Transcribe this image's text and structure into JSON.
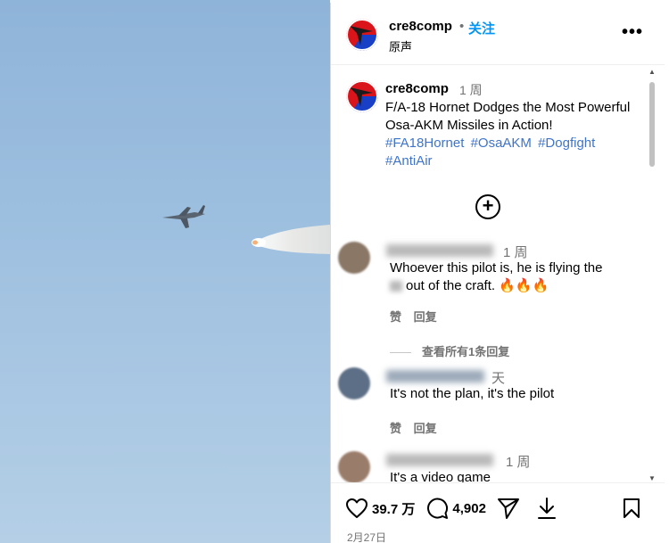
{
  "post": {
    "username": "cre8comp",
    "follow_label": "关注",
    "audio_label": "原声",
    "more_label": "•••",
    "caption_time": "1 周",
    "caption_text": "F/A-18 Hornet Dodges the Most Powerful Osa-AKM Missiles in Action!",
    "hashtags": [
      "#FA18Hornet",
      "#OsaAKM",
      "#Dogfight",
      "#AntiAir"
    ],
    "date": "2月27日"
  },
  "comments": [
    {
      "time": "1 周",
      "text_line1": "Whoever this pilot is, he is flying the",
      "text_line2": "out of the craft. 🔥🔥🔥",
      "like_label": "赞",
      "reply_label": "回复"
    },
    {
      "time": "天",
      "text_line1": "It's not the plan, it's the pilot",
      "like_label": "赞",
      "reply_label": "回复"
    },
    {
      "time": "1 周",
      "text_line1": "It's a video game"
    }
  ],
  "view_replies_label": "查看所有1条回复",
  "stats": {
    "likes": "39.7 万",
    "comments": "4,902"
  },
  "icons": {
    "like": "heart-icon",
    "comment": "comment-icon",
    "share": "send-icon",
    "download": "download-icon",
    "save": "bookmark-icon",
    "add": "plus-circle-icon"
  },
  "colors": {
    "link": "#3f74c9",
    "follow": "#0095f6",
    "muted": "#737373"
  }
}
